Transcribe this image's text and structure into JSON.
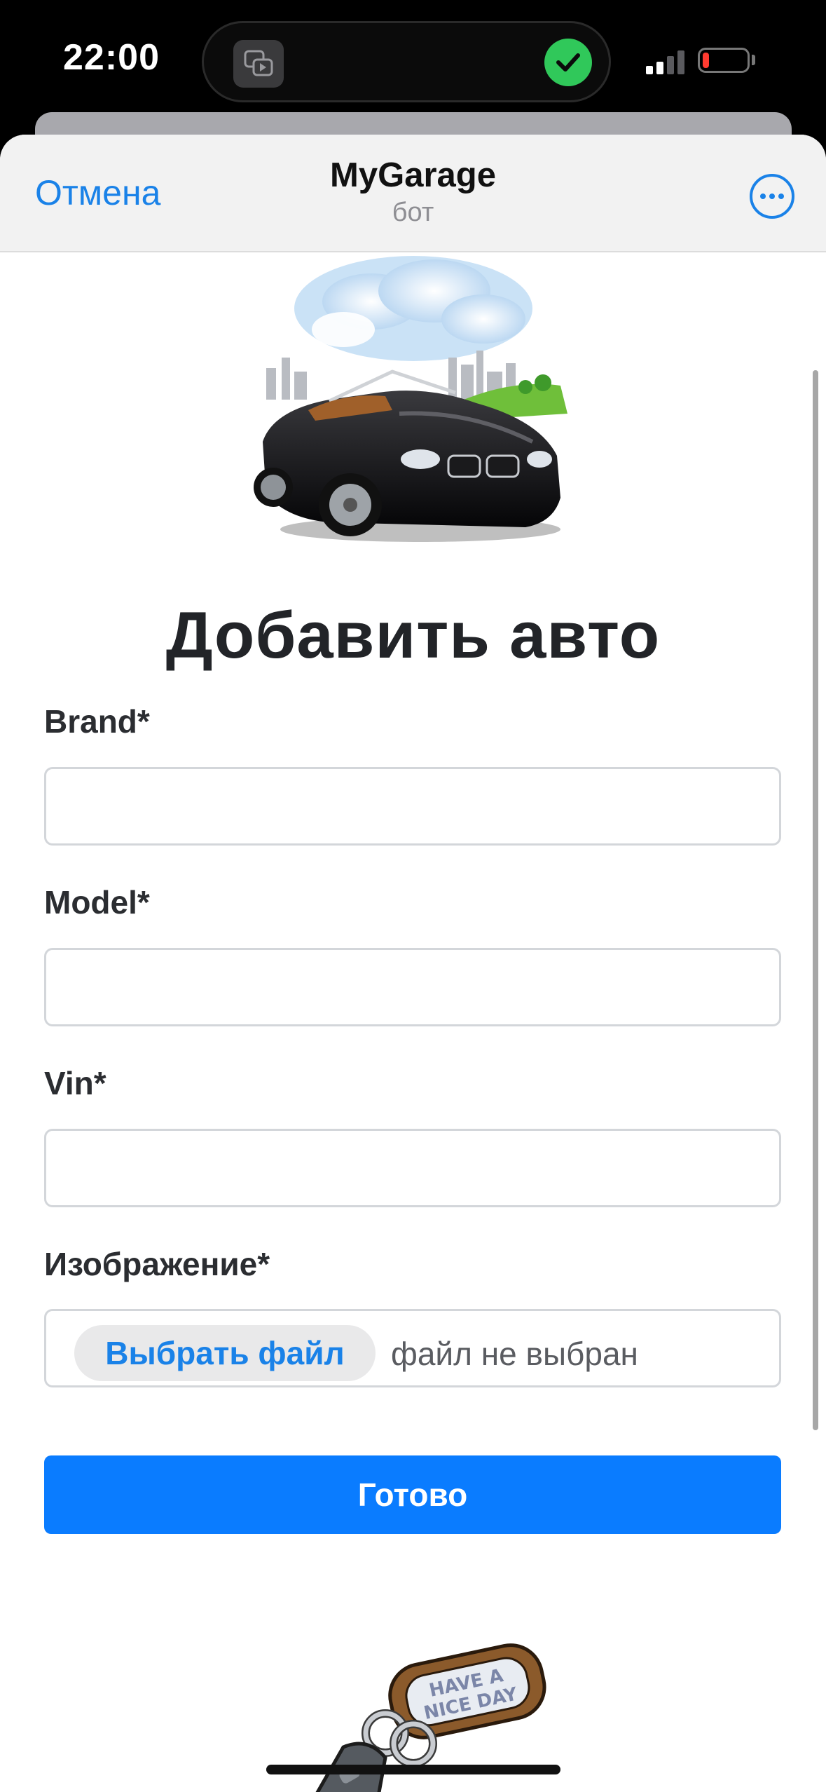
{
  "status_bar": {
    "time": "22:00",
    "island_app_icon": "screen-mirroring-icon",
    "island_status_icon": "checkmark-icon",
    "signal_icon": "cellular-signal-icon",
    "battery_icon": "battery-low-icon"
  },
  "header": {
    "cancel_label": "Отмена",
    "title": "MyGarage",
    "subtitle": "бот",
    "more_icon": "more-ellipsis-icon"
  },
  "form": {
    "title": "Добавить авто",
    "fields": [
      {
        "label": "Brand*",
        "value": "",
        "placeholder": ""
      },
      {
        "label": "Model*",
        "value": "",
        "placeholder": ""
      },
      {
        "label": "Vin*",
        "value": "",
        "placeholder": ""
      }
    ],
    "image": {
      "label": "Изображение*",
      "button_label": "Выбрать файл",
      "status": "файл не выбран"
    },
    "submit_label": "Готово"
  },
  "images": {
    "hero": "convertible-car-illustration",
    "footer": "car-keys-have-a-nice-day-illustration",
    "keychain_text": [
      "HAVE A",
      "NICE DAY"
    ]
  },
  "colors": {
    "accent": "#1a82e8",
    "primary_button": "#0a7cff",
    "island_check": "#30c85a",
    "battery_low": "#ff3b30"
  }
}
